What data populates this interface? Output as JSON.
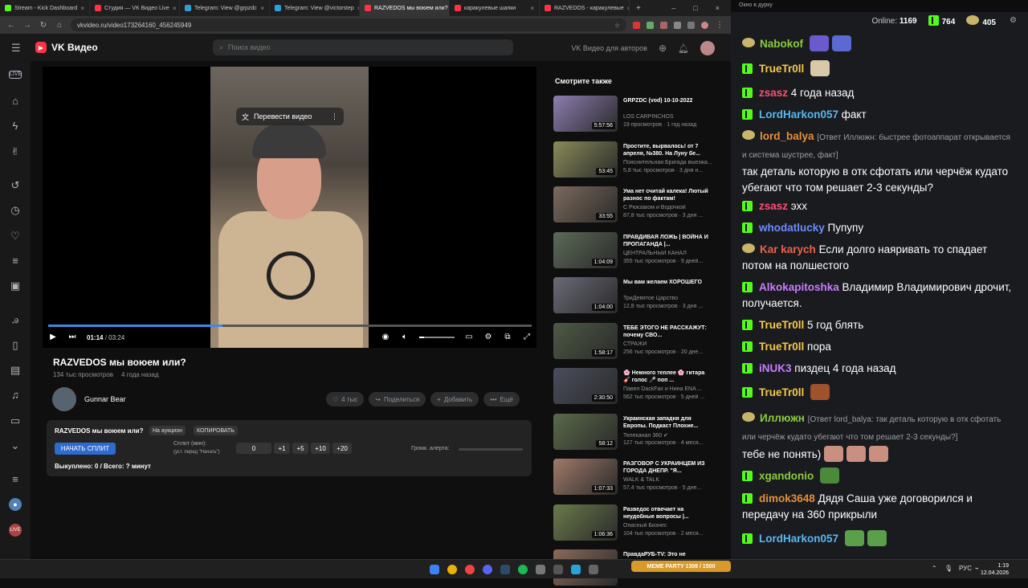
{
  "browser": {
    "tabs": [
      {
        "label": "Stream - Kick Dashboard",
        "color": "#53fc18"
      },
      {
        "label": "Студия — VK Видео Live",
        "color": "#ff3347"
      },
      {
        "label": "Telegram: View @grpzdc",
        "color": "#2aa1d9"
      },
      {
        "label": "Telegram: View @victorstep",
        "color": "#2aa1d9"
      },
      {
        "label": "RAZVEDOS мы воюем или?",
        "color": "#ff3347"
      },
      {
        "label": "каракулевые шапки",
        "color": "#ff3347"
      },
      {
        "label": "RAZVEDOS - каракулевые",
        "color": "#ff3347"
      }
    ],
    "url": "vkvideo.ru/video173264160_456245949"
  },
  "header": {
    "brand": "VK Видео",
    "search_placeholder": "Поиск видео",
    "for_authors": "VK Видео для авторов"
  },
  "video": {
    "translate_label": "Перевести видео",
    "time_current": "01:14",
    "time_total": "03:24",
    "progress_fraction": 0.36,
    "title": "RAZVEDOS мы воюем или?",
    "views": "134 тыс просмотров",
    "age": "4 года назад",
    "channel": "Gunnar Bear",
    "likes": "4 тыс",
    "share": "Поделиться",
    "add": "Добавить",
    "more": "Ещё"
  },
  "widget": {
    "title": "RAZVEDOS мы воюем или?",
    "auction": "На аукцион",
    "copy": "КОПИРОВАТЬ",
    "start": "НАЧАТЬ СПЛИТ",
    "split_label": "Сплит (мин):",
    "split_hint": "(уст. перед \"Начать\")",
    "split_value": "0",
    "inc1": "+1",
    "inc5": "+5",
    "inc10": "+10",
    "inc20": "+20",
    "volume_label": "Громк. алерта:",
    "footer": "Выкуплено: 0 / Всего: ? минут"
  },
  "recommendations": {
    "heading": "Смотрите также",
    "items": [
      {
        "title": "GRPZDC (vod) 10-10-2022",
        "channel": "LOS CARPINCHOS",
        "stats": "19 просмотров · 1 год назад",
        "duration": "5:57:56",
        "thumb": "#8d7db0"
      },
      {
        "title": "Простите, вырвалось! от 7 апреля, №380. На Луну бе...",
        "channel": "Пояснительная Бригада выезжа...",
        "stats": "5,8 тыс просмотров · 3 дня н...",
        "duration": "53:45",
        "thumb": "#8a8b5a"
      },
      {
        "title": "Ума нет считай калека! Лютый разнос по фактам!",
        "channel": "С Рюкзаком и Водочкой",
        "stats": "87,8 тыс просмотров · 3 дня ...",
        "duration": "33:55",
        "thumb": "#7c6a5c"
      },
      {
        "title": "ПРАВДИВАЯ ЛОЖЬ | ВОЙНА И ПРОПАГАНДА |...",
        "channel": "ЦЕНТРАЛЬНЫЙ КАНАЛ",
        "stats": "355 тыс просмотров · 9 дней...",
        "duration": "1:04:09",
        "thumb": "#5d6a58"
      },
      {
        "title": "Мы вам желаем ХОРОШЕГО",
        "channel": "ТриДевятое Царство",
        "stats": "12,8 тыс просмотров · 3 дня ...",
        "duration": "1:04:00",
        "thumb": "#6a6a78"
      },
      {
        "title": "ТЕБЕ ЭТОГО НЕ РАССКАЖУТ: почему СВО...",
        "channel": "СТРАЖИ",
        "stats": "256 тыс просмотров · 20 дне...",
        "duration": "1:58:17",
        "thumb": "#4d5a44"
      },
      {
        "title": "🌸 Немного теплее 🌸 гитара 🎸 голос 🎤 поп ...",
        "channel": "Павел DackFax и Нина ENA ...",
        "stats": "562 тыс просмотров · 5 дней ...",
        "duration": "2:30:50",
        "thumb": "#4a4e5c"
      },
      {
        "title": "Украинская западня для Европы. Подкаст Плохие...",
        "channel": "Телеканал 360 ✔",
        "stats": "127 тыс просмотров · 4 меся...",
        "duration": "58:12",
        "thumb": "#5a6a4a"
      },
      {
        "title": "РАЗГОВОР С УКРАИНЦЕМ ИЗ ГОРОДА ДНЕПР. \"Я...",
        "channel": "WALK & TALK",
        "stats": "57,4 тыс просмотров · 5 дне...",
        "duration": "1:07:33",
        "thumb": "#a07a6a"
      },
      {
        "title": "Разведос отвечает на неудобные вопросы |...",
        "channel": "Опасный Бизнес",
        "stats": "104 тыс просмотров · 2 меся...",
        "duration": "1:06:36",
        "thumb": "#6a7a4a"
      },
      {
        "title": "ПравдаРУБ-TV: Это не переговоры. Это...",
        "channel": "",
        "stats": "",
        "duration": "",
        "thumb": "#8a6a5a"
      }
    ]
  },
  "chat": {
    "window_title": "Окно в дурку",
    "online_label": "Online:",
    "online_count": "1169",
    "kick_count": "764",
    "viewers_count": "405",
    "messages": [
      {
        "user": "Nabokof",
        "color": "#8ecb3c",
        "text": ""
      },
      {
        "user": "TrueTr0ll",
        "color": "#f7c948",
        "text": ""
      },
      {
        "user": "zsasz",
        "color": "#ff4f6d",
        "text": "4 года назад"
      },
      {
        "user": "LordHarkon057",
        "color": "#56b8f0",
        "text": "факт"
      },
      {
        "user": "lord_balya",
        "color": "#e58f3a",
        "reply": "[Ответ Иллюжн: быстрее фотоаппарат открывается и система шустрее, факт]",
        "text": "так деталь которую в отк сфотать или черчёж кудато убегают что том решает 2-3 секунды?"
      },
      {
        "user": "zsasz",
        "color": "#ff4f6d",
        "text": "эхх"
      },
      {
        "user": "whodatlucky",
        "color": "#6e8cff",
        "text": "Пупупу"
      },
      {
        "user": "Kar karych",
        "color": "#e8644c",
        "text": "Если долго наяривать то спадает потом на полшестого"
      },
      {
        "user": "Alkokapitoshka",
        "color": "#c77dff",
        "text": "Владимир Владимирович дрочит, получается."
      },
      {
        "user": "TrueTr0ll",
        "color": "#f7c948",
        "text": "5 год блять"
      },
      {
        "user": "TrueTr0ll",
        "color": "#f7c948",
        "text": "пора"
      },
      {
        "user": "iNUK3",
        "color": "#c77dff",
        "text": "пиздец 4 года назад"
      },
      {
        "user": "TrueTr0ll",
        "color": "#f7c948",
        "text": ""
      },
      {
        "user": "Иллюжн",
        "color": "#8ecb3c",
        "reply": "[Ответ lord_balya: так деталь которую в отк сфотать или черчёж кудато убегают что том решает 2-3 секунды?]",
        "text": "тебе не понять)"
      },
      {
        "user": "xgandonio",
        "color": "#8ecb3c",
        "text": ""
      },
      {
        "user": "dimok3648",
        "color": "#e58f3a",
        "text": "Дядя Саша уже договорился и передачу на 360 прикрыли"
      },
      {
        "user": "LordHarkon057",
        "color": "#56b8f0",
        "text": ""
      }
    ]
  },
  "taskbar": {
    "lang": "РУС",
    "time": "1:19",
    "date": "12.04.2026",
    "promo": "MEME PARTY 1308 / 1500"
  }
}
